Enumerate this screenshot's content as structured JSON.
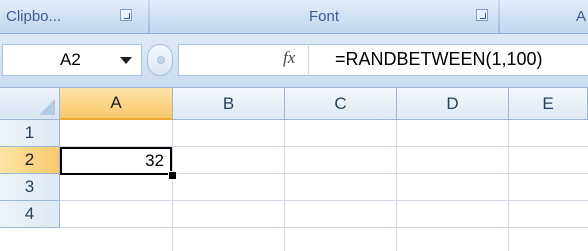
{
  "ribbon": {
    "groups": [
      {
        "label": "Clipbo..."
      },
      {
        "label": "Font"
      },
      {
        "label": "A"
      }
    ]
  },
  "formula_bar": {
    "name_box": "A2",
    "fx_label": "fx",
    "formula": "=RANDBETWEEN(1,100)"
  },
  "sheet": {
    "columns": [
      "A",
      "B",
      "C",
      "D",
      "E"
    ],
    "rows": [
      "1",
      "2",
      "3",
      "4"
    ],
    "active_cell": {
      "ref": "A2",
      "value": "32"
    }
  }
}
